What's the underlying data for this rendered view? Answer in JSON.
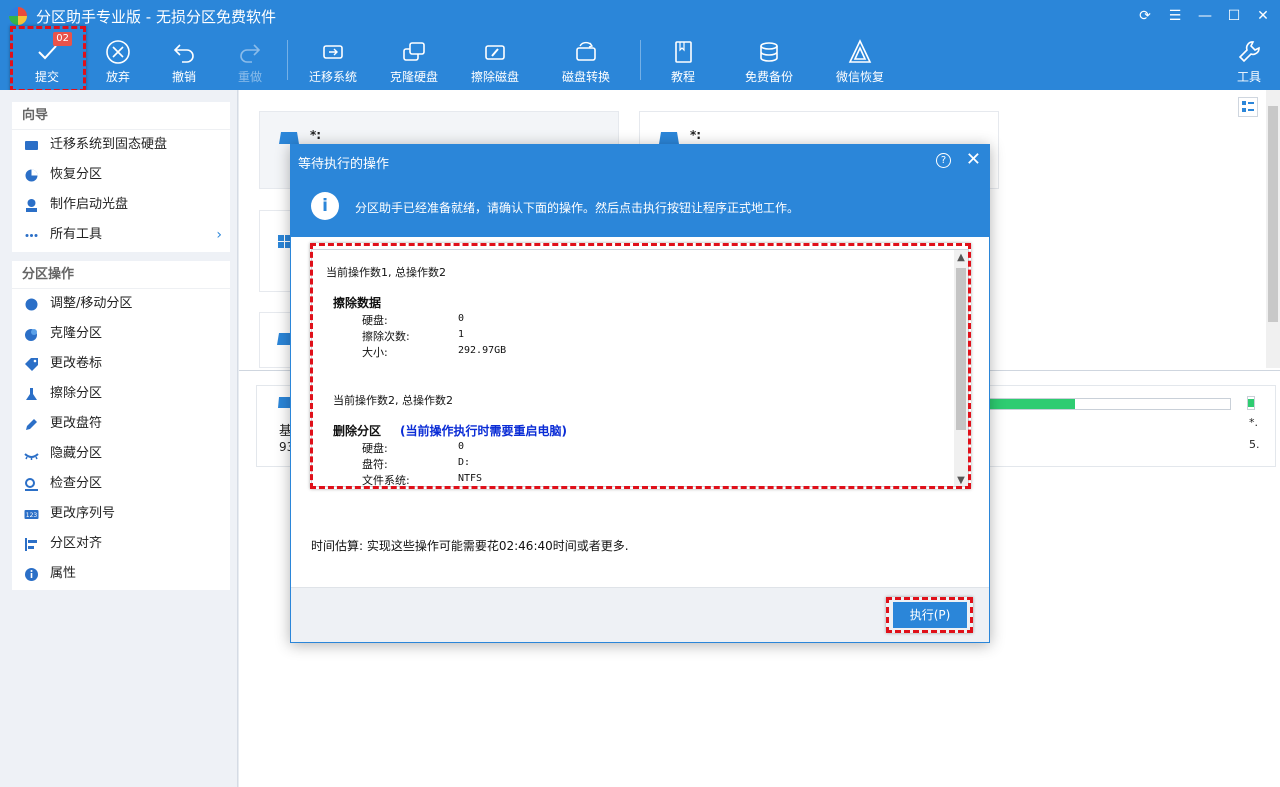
{
  "window": {
    "title": "分区助手专业版 - 无损分区免费软件"
  },
  "toolbar": {
    "commit": {
      "label": "提交",
      "badge": "02"
    },
    "discard": {
      "label": "放弃"
    },
    "undo": {
      "label": "撤销"
    },
    "redo": {
      "label": "重做"
    },
    "migrate": {
      "label": "迁移系统"
    },
    "clone": {
      "label": "克隆硬盘"
    },
    "wipe": {
      "label": "擦除磁盘"
    },
    "convert": {
      "label": "磁盘转换"
    },
    "tutorial": {
      "label": "教程"
    },
    "backup": {
      "label": "免费备份"
    },
    "wechat": {
      "label": "微信恢复"
    },
    "tools": {
      "label": "工具"
    }
  },
  "sidebar": {
    "wizard_title": "向导",
    "wizard_items": [
      {
        "label": "迁移系统到固态硬盘",
        "icon": "migrate-ssd-icon"
      },
      {
        "label": "恢复分区",
        "icon": "recover-partition-icon"
      },
      {
        "label": "制作启动光盘",
        "icon": "bootable-media-icon"
      },
      {
        "label": "所有工具",
        "icon": "all-tools-icon"
      }
    ],
    "ops_title": "分区操作",
    "ops_items": [
      {
        "label": "调整/移动分区",
        "icon": "resize-partition-icon"
      },
      {
        "label": "克隆分区",
        "icon": "clone-partition-icon"
      },
      {
        "label": "更改卷标",
        "icon": "label-tag-icon"
      },
      {
        "label": "擦除分区",
        "icon": "wipe-partition-icon"
      },
      {
        "label": "更改盘符",
        "icon": "drive-letter-icon"
      },
      {
        "label": "隐藏分区",
        "icon": "hide-partition-icon"
      },
      {
        "label": "检查分区",
        "icon": "check-partition-icon"
      },
      {
        "label": "更改序列号",
        "icon": "serial-number-icon"
      },
      {
        "label": "分区对齐",
        "icon": "align-partition-icon"
      },
      {
        "label": "属性",
        "icon": "properties-icon"
      }
    ]
  },
  "main": {
    "card1_label": "*:",
    "card2_label": "*:",
    "disk_label": "基",
    "disk_size": "93",
    "right_label1": "*.",
    "right_label2": "5."
  },
  "dialog": {
    "title": "等待执行的操作",
    "help": "?",
    "info": "分区助手已经准备就绪，请确认下面的操作。然后点击执行按钮让程序正式地工作。",
    "op1": {
      "header": "当前操作数1, 总操作数2",
      "name": "擦除数据",
      "rows": [
        {
          "k": "硬盘:",
          "v": "0"
        },
        {
          "k": "擦除次数:",
          "v": "1"
        },
        {
          "k": "大小:",
          "v": "292.97GB"
        }
      ]
    },
    "op2": {
      "header": "当前操作数2, 总操作数2",
      "name": "删除分区",
      "note": "(当前操作执行时需要重启电脑)",
      "rows": [
        {
          "k": "硬盘:",
          "v": "0"
        },
        {
          "k": "盘符:",
          "v": "D:"
        },
        {
          "k": "文件系统:",
          "v": "NTFS"
        }
      ]
    },
    "time_estimate": "时间估算: 实现这些操作可能需要花02:46:40时间或者更多.",
    "execute_label": "执行(P)"
  },
  "colors": {
    "primary": "#2b86d9",
    "highlight_dash": "#e0101a",
    "progress": "#2ecc71"
  }
}
